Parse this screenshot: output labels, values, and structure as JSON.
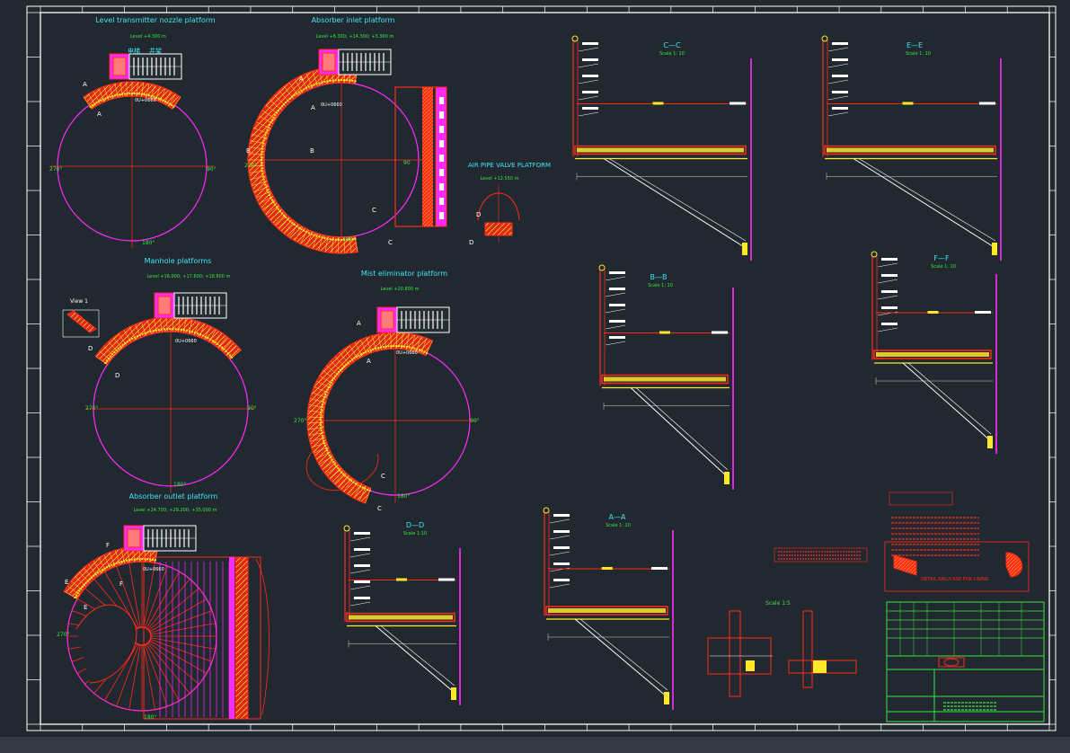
{
  "drawing": {
    "colors": {
      "background": "#212830",
      "frame": "#ffffff",
      "cyan": "#3fe6f2",
      "green": "#38e83c",
      "red": "#ff2a1a",
      "magenta": "#ff2aff",
      "yellow": "#ffe82a",
      "white": "#ffffff"
    },
    "views": {
      "level_transmitter": {
        "title": "Level transmitter nozzle platform",
        "level": "Level +4.300 m",
        "labels": {
          "deg270": "270°",
          "deg90": "90°",
          "deg180": "180°",
          "a_top": "A",
          "a_bot": "A",
          "marker": "0U+0660",
          "ladder_left": "电梯",
          "ladder_right": "井架"
        }
      },
      "absorber_inlet": {
        "title": "Absorber inlet platform",
        "level": "Level +6.300; +14.300; +3.300 m",
        "labels": {
          "deg270": "270°",
          "deg90": "90",
          "deg180": "180°",
          "b_left": "B",
          "b_right": "B",
          "a_top": "A",
          "a_bot": "A",
          "c_top": "C",
          "c_bot": "C",
          "marker": "0U+0660"
        }
      },
      "air_pipe": {
        "title": "AIR PIPE VALVE PLATFORM",
        "level": "Level +12.550 m",
        "labels": {
          "d_top": "D",
          "d_bot": "D"
        }
      },
      "manhole": {
        "title": "Manhole platforms",
        "level": "Level +16.000; +17.600; +18.800 m",
        "labels": {
          "view": "View 1",
          "deg270": "270°",
          "deg90": "90°",
          "deg180": "180°",
          "d_top": "D",
          "d_bot": "D",
          "marker": "0U+0660"
        }
      },
      "mist_eliminator": {
        "title": "Mist eliminator platform",
        "level": "Level +20.800 m",
        "labels": {
          "deg270": "270°",
          "deg90": "90°",
          "deg180": "180°",
          "a_top": "A",
          "a_bot": "A",
          "c_top": "C",
          "c_bot": "C",
          "marker": "0U+0660"
        }
      },
      "absorber_outlet": {
        "title": "Absorber outlet platform",
        "level": "Level +24.700; +29.200; +35.000 m",
        "labels": {
          "deg270": "270°",
          "deg180": "180°",
          "e_top": "E",
          "e_bot": "E",
          "f_top": "F",
          "f_bot": "F",
          "marker": "0U+0660"
        }
      }
    },
    "sections": [
      {
        "id": "cc",
        "title": "C—C",
        "scale": "Scale 1: 10"
      },
      {
        "id": "ee",
        "title": "E—E",
        "scale": "Scale 1: 10"
      },
      {
        "id": "bb",
        "title": "B—B",
        "scale": "Scale 1: 10"
      },
      {
        "id": "ff",
        "title": "F—F",
        "scale": "Scale 1: 10"
      },
      {
        "id": "dd",
        "title": "D—D",
        "scale": "Scale 1:10"
      },
      {
        "id": "aa",
        "title": "A—A",
        "scale": "Scale 1: 10"
      },
      {
        "id": "detail",
        "title": "",
        "scale": "Scale 1:5"
      }
    ],
    "legend": {
      "detail_title": "DETAIL RAIL/CASE FOR LINING"
    }
  }
}
